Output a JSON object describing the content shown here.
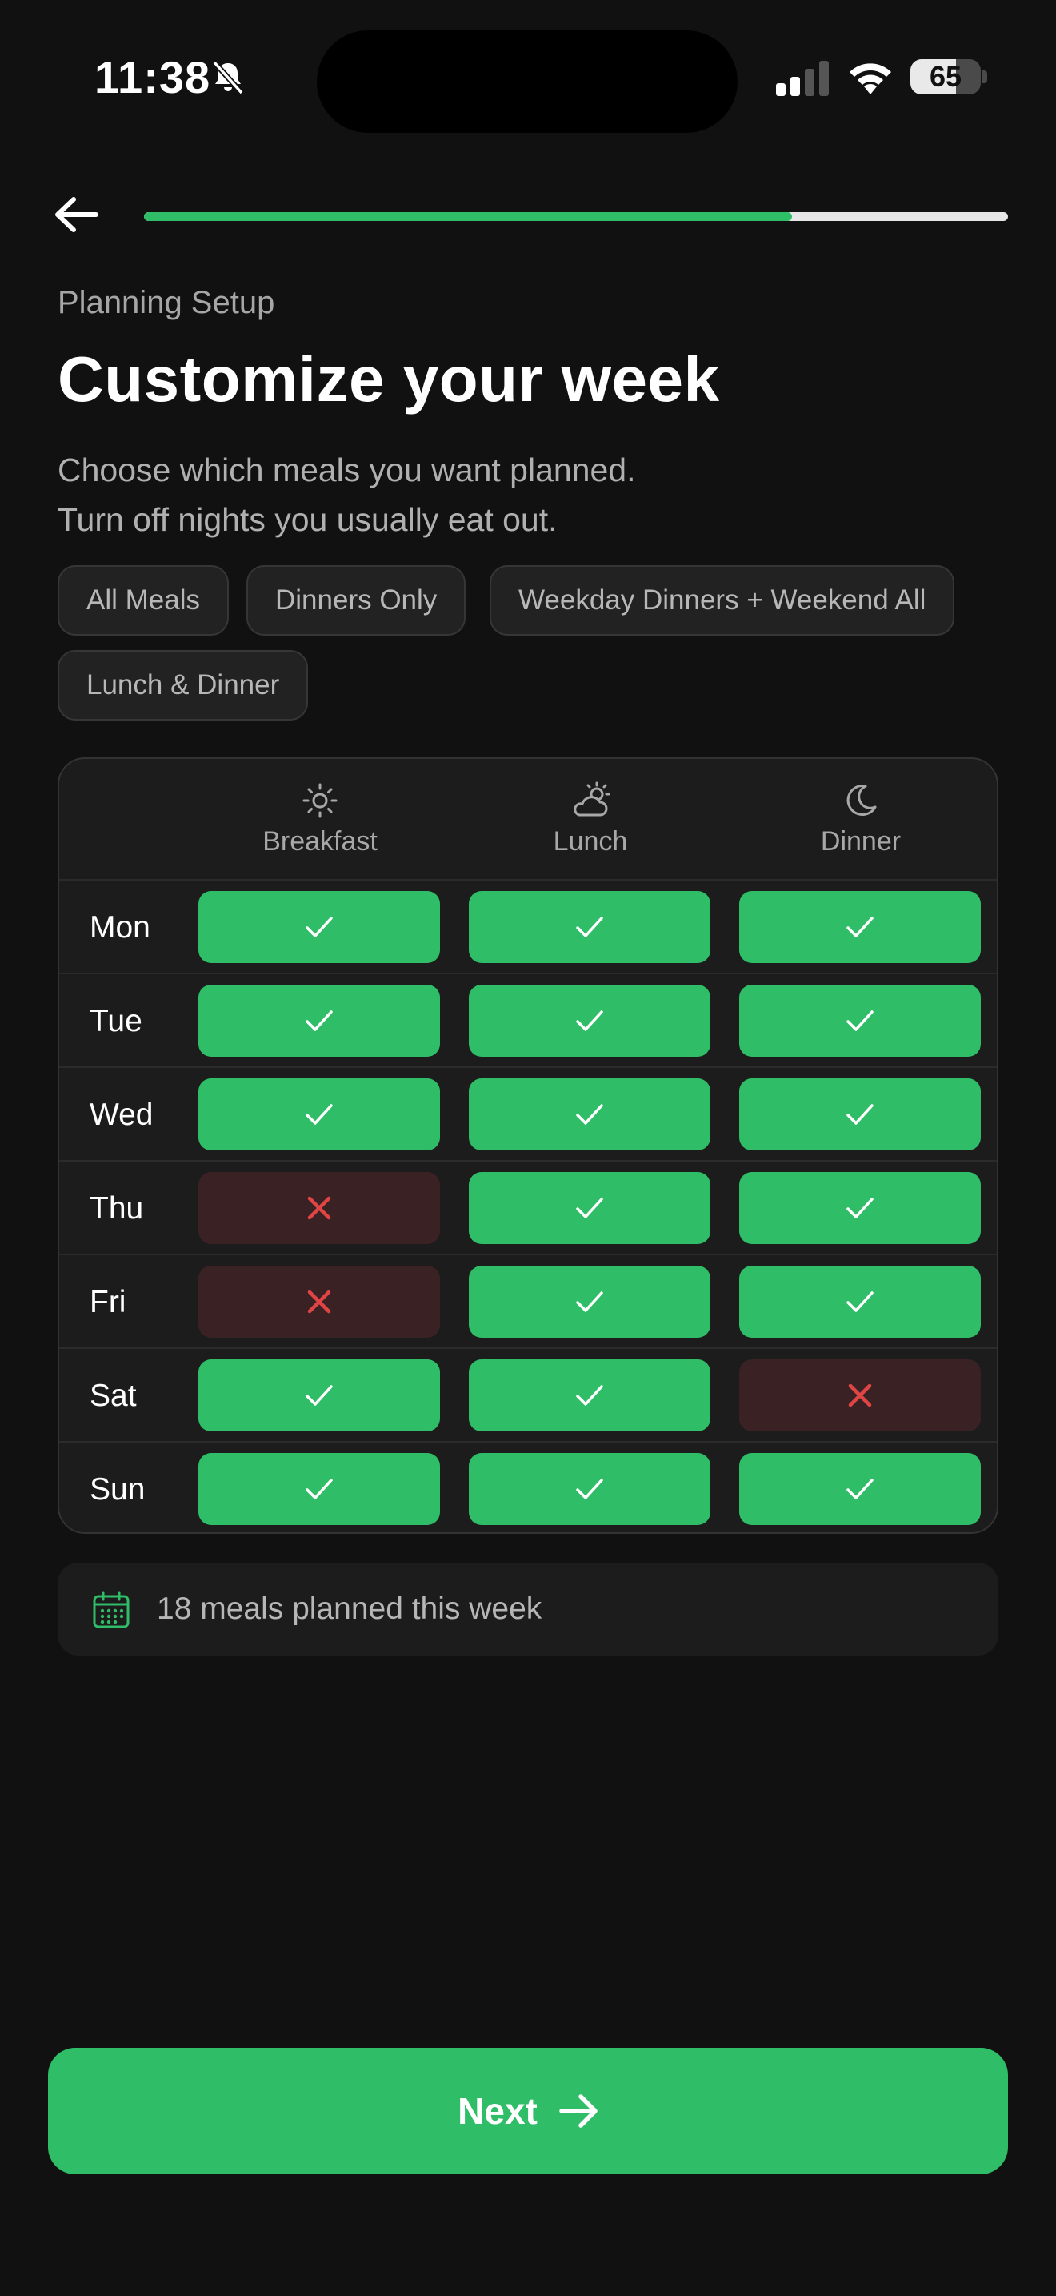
{
  "status_bar": {
    "time": "11:38",
    "battery": "65",
    "battery_level": 0.65,
    "icons": [
      "bell-slash-icon",
      "cellular-signal-icon",
      "wifi-icon",
      "battery-icon"
    ]
  },
  "header": {
    "back_icon": "arrow-left-icon",
    "progress": 0.75
  },
  "page": {
    "eyebrow": "Planning Setup",
    "title": "Customize your week",
    "subtitle_line1": "Choose which meals you want planned.",
    "subtitle_line2": "Turn off nights you usually eat out."
  },
  "presets": [
    {
      "label": "All Meals"
    },
    {
      "label": "Dinners Only"
    },
    {
      "label": "Weekday Dinners + Weekend All"
    },
    {
      "label": "Lunch & Dinner"
    }
  ],
  "grid": {
    "columns": [
      {
        "label": "Breakfast",
        "icon": "sun-icon"
      },
      {
        "label": "Lunch",
        "icon": "partly-cloudy-icon"
      },
      {
        "label": "Dinner",
        "icon": "moon-icon"
      }
    ],
    "rows": [
      {
        "day": "Mon",
        "meals": [
          true,
          true,
          true
        ]
      },
      {
        "day": "Tue",
        "meals": [
          true,
          true,
          true
        ]
      },
      {
        "day": "Wed",
        "meals": [
          true,
          true,
          true
        ]
      },
      {
        "day": "Thu",
        "meals": [
          false,
          true,
          true
        ]
      },
      {
        "day": "Fri",
        "meals": [
          false,
          true,
          true
        ]
      },
      {
        "day": "Sat",
        "meals": [
          true,
          true,
          false
        ]
      },
      {
        "day": "Sun",
        "meals": [
          true,
          true,
          true
        ]
      }
    ]
  },
  "summary": {
    "icon": "calendar-icon",
    "text": "18 meals planned this week"
  },
  "footer": {
    "next_label": "Next",
    "next_icon": "arrow-right-icon"
  },
  "colors": {
    "accent": "#2fbd67",
    "off_cell": "#3a2224",
    "off_x": "#e04545",
    "background": "#111111"
  }
}
